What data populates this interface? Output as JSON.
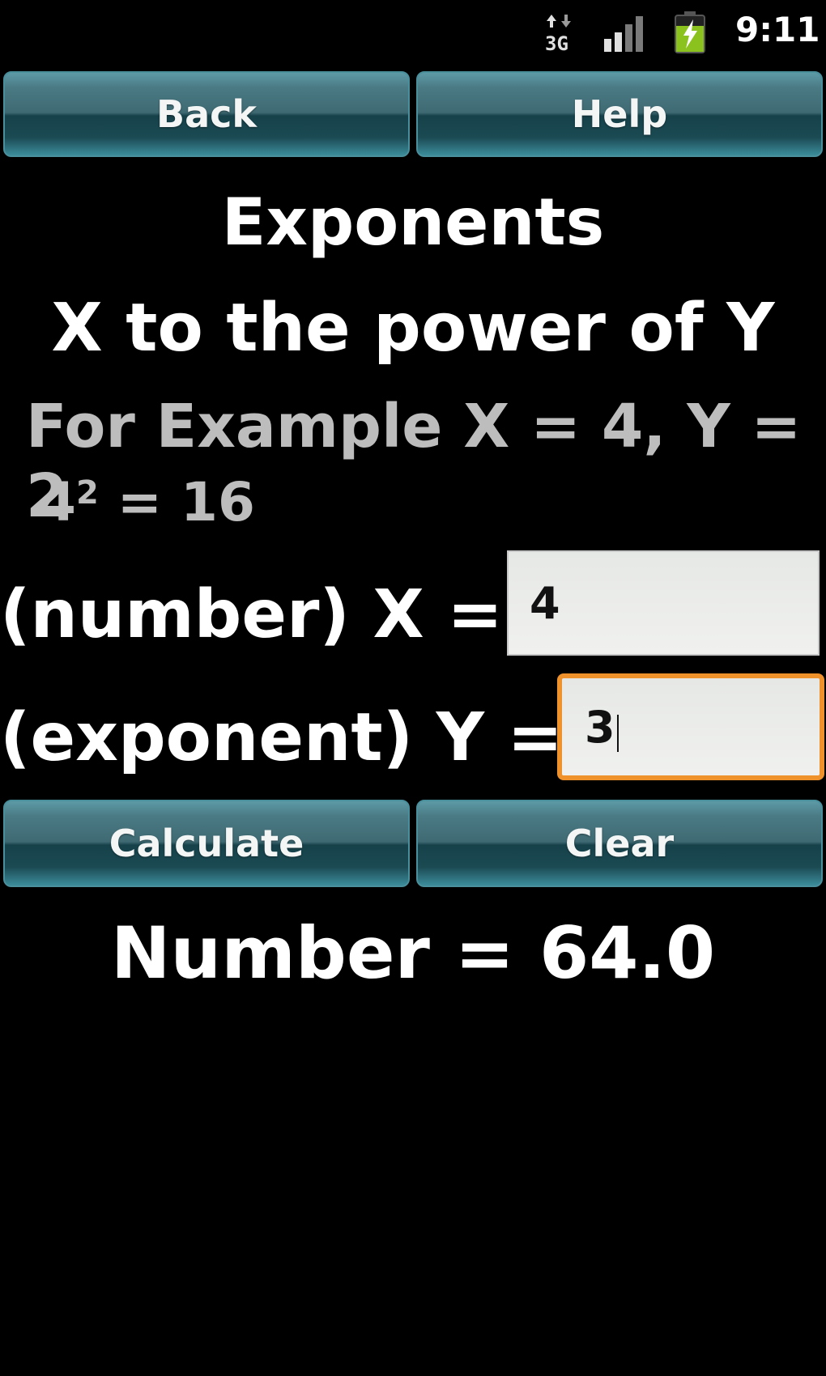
{
  "status_bar": {
    "network": "3G",
    "network_icon": "data-3g-icon",
    "signal_icon": "signal-strength-icon",
    "signal_bars": 4,
    "signal_bars_active": 2,
    "battery_icon": "battery-charging-icon",
    "battery_color": "#8cc21e",
    "time": "9:11"
  },
  "top_buttons": {
    "back_label": "Back",
    "help_label": "Help"
  },
  "header": {
    "title": "Exponents",
    "subtitle": "X to the power of Y"
  },
  "example": {
    "line1": "For Example X = 4, Y = 2",
    "base": "4",
    "exponent": "2",
    "result_text": " = 16"
  },
  "inputs": {
    "x_label": "(number) X =",
    "x_value": "4",
    "y_label": "(exponent) Y =",
    "y_value": "3",
    "focus_color": "#f0922b"
  },
  "actions": {
    "calculate_label": "Calculate",
    "clear_label": "Clear"
  },
  "result": {
    "text": "Number = 64.0"
  },
  "colors": {
    "button_teal": "#1b4a53",
    "example_gray": "#bdbdbd",
    "background": "#000000"
  }
}
